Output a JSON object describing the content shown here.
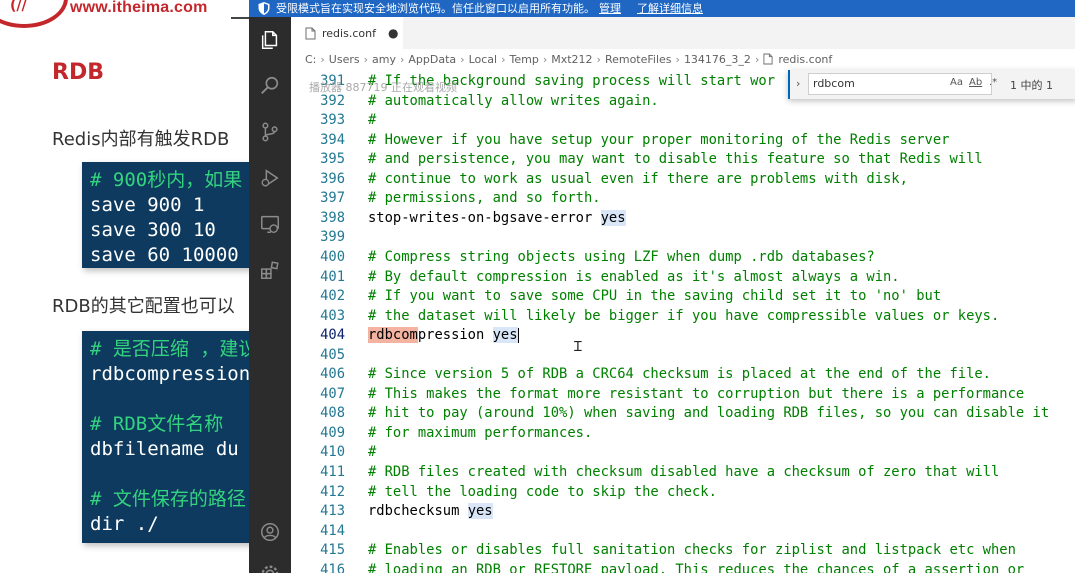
{
  "slide": {
    "logo_text": "(//",
    "site_url": "www.itheima.com",
    "title": "RDB",
    "text1": "Redis内部有触发RDB",
    "text2": "RDB的其它配置也可以",
    "code_box1": [
      {
        "text": "# 900秒内，如果",
        "comment": true
      },
      {
        "text": "save 900 1",
        "comment": false
      },
      {
        "text": "save 300 10",
        "comment": false
      },
      {
        "text": "save 60 10000",
        "comment": false
      }
    ],
    "code_box2": [
      {
        "text": "# 是否压缩 ，建议",
        "comment": true
      },
      {
        "text": "rdbcompression",
        "comment": false
      },
      {
        "text": "",
        "comment": false
      },
      {
        "text": "# RDB文件名称",
        "comment": true
      },
      {
        "text": "dbfilename du",
        "comment": false
      },
      {
        "text": "",
        "comment": false
      },
      {
        "text": "# 文件保存的路径",
        "comment": true
      },
      {
        "text": "dir ./",
        "comment": false
      }
    ]
  },
  "banner": {
    "message": "受限模式旨在实现安全地浏览代码。信任此窗口以启用所有功能。",
    "manage_link": "管理",
    "learn_more_link": "了解详细信息"
  },
  "activity_bar": {
    "icons": [
      "explorer-icon",
      "search-icon",
      "source-control-icon",
      "run-debug-icon",
      "remote-explorer-icon",
      "extensions-icon",
      "account-icon",
      "settings-icon"
    ]
  },
  "tab": {
    "file_name": "redis.conf",
    "modified_dot": "●"
  },
  "breadcrumb": [
    "C:",
    "Users",
    "amy",
    "AppData",
    "Local",
    "Temp",
    "Mxt212",
    "RemoteFiles",
    "134176_3_2",
    "redis.conf"
  ],
  "ghost_text": "播放器 887719 正在观看视频",
  "find_widget": {
    "query": "rdbcom",
    "match_case": "Aa",
    "whole_word": "Ab",
    "regex": ".*",
    "result": "1 中的 1"
  },
  "editor": {
    "active_line": 404,
    "lines": [
      {
        "n": 391,
        "text": "# If the background saving process will start wor"
      },
      {
        "n": 392,
        "text": "# automatically allow writes again."
      },
      {
        "n": 393,
        "text": "#"
      },
      {
        "n": 394,
        "text": "# However if you have setup your proper monitoring of the Redis server"
      },
      {
        "n": 395,
        "text": "# and persistence, you may want to disable this feature so that Redis will"
      },
      {
        "n": 396,
        "text": "# continue to work as usual even if there are problems with disk,"
      },
      {
        "n": 397,
        "text": "# permissions, and so forth."
      },
      {
        "n": 398,
        "text": "stop-writes-on-bgsave-error ",
        "value": "yes"
      },
      {
        "n": 399,
        "text": ""
      },
      {
        "n": 400,
        "text": "# Compress string objects using LZF when dump .rdb databases?"
      },
      {
        "n": 401,
        "text": "# By default compression is enabled as it's almost always a win."
      },
      {
        "n": 402,
        "text": "# If you want to save some CPU in the saving child set it to 'no' but"
      },
      {
        "n": 403,
        "text": "# the dataset will likely be bigger if you have compressible values or keys."
      },
      {
        "n": 404,
        "find_match": "rdbcom",
        "text": "pression ",
        "value": "yes"
      },
      {
        "n": 405,
        "text": ""
      },
      {
        "n": 406,
        "text": "# Since version 5 of RDB a CRC64 checksum is placed at the end of the file."
      },
      {
        "n": 407,
        "text": "# This makes the format more resistant to corruption but there is a performance"
      },
      {
        "n": 408,
        "text": "# hit to pay (around 10%) when saving and loading RDB files, so you can disable it"
      },
      {
        "n": 409,
        "text": "# for maximum performances."
      },
      {
        "n": 410,
        "text": "#"
      },
      {
        "n": 411,
        "text": "# RDB files created with checksum disabled have a checksum of zero that will"
      },
      {
        "n": 412,
        "text": "# tell the loading code to skip the check."
      },
      {
        "n": 413,
        "text": "rdbchecksum ",
        "value": "yes"
      },
      {
        "n": 414,
        "text": ""
      },
      {
        "n": 415,
        "text": "# Enables or disables full sanitation checks for ziplist and listpack etc when"
      },
      {
        "n": 416,
        "text": "# loading an RDB or RESTORE payload. This reduces the chances of a assertion or"
      }
    ]
  },
  "colors": {
    "banner_bg": "#1f67c2",
    "comment": "#008000",
    "line_number": "#237893",
    "slide_accent": "#c3272b",
    "code_box_bg": "#0d3a5e"
  }
}
